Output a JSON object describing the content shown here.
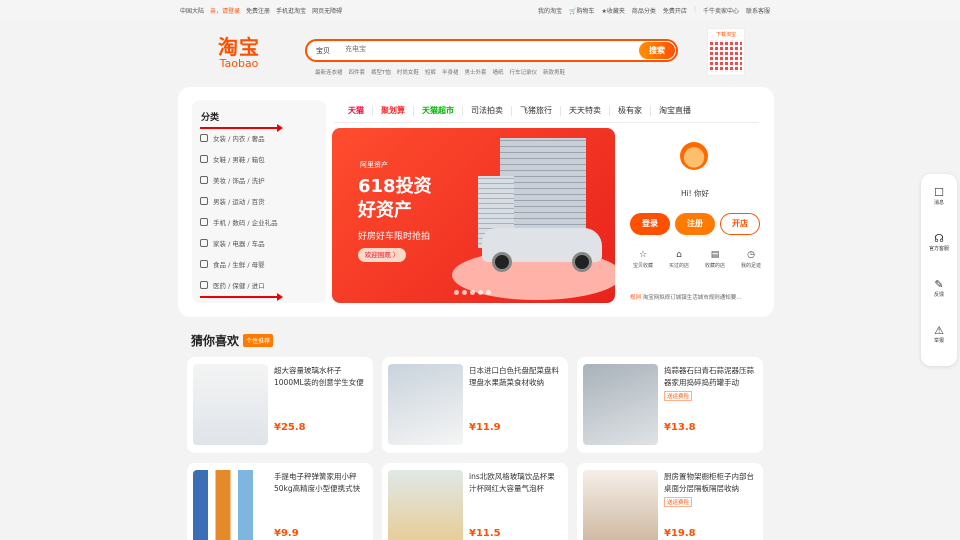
{
  "topbar": {
    "left": [
      "中国大陆",
      "亲，请登录",
      "免费注册",
      "手机逛淘宝",
      "网页无障碍"
    ],
    "right": [
      "我的淘宝",
      "购物车",
      "收藏夹",
      "商品分类",
      "免费开店",
      "千牛卖家中心",
      "联系客服"
    ]
  },
  "logo": {
    "cn": "淘宝",
    "en": "Taobao"
  },
  "search": {
    "category": "宝贝",
    "placeholder": "充电宝",
    "button": "搜索",
    "hotwords": [
      "最新连衣裙",
      "四件套",
      "裤型T恤",
      "时尚女鞋",
      "短裤",
      "半身裙",
      "男士外套",
      "墙纸",
      "行车记录仪",
      "新款男鞋"
    ]
  },
  "qrcode": {
    "label": "下载淘宝"
  },
  "categories": {
    "title": "分类",
    "items": [
      "女装 / 内衣 / 奢品",
      "女鞋 / 男鞋 / 箱包",
      "美妆 / 饰品 / 洗护",
      "男装 / 运动 / 百货",
      "手机 / 数码 / 企业礼品",
      "家装 / 电器 / 车品",
      "食品 / 生鲜 / 母婴",
      "医药 / 保健 / 进口"
    ]
  },
  "channels": [
    "天猫",
    "聚划算",
    "天猫超市",
    "司法拍卖",
    "飞猪旅行",
    "天天特卖",
    "极有家",
    "淘宝直播"
  ],
  "channel_colors": [
    "#ff0036",
    "#ff2d2d",
    "#00b500",
    "#333333",
    "#333333",
    "#333333",
    "#333333",
    "#333333"
  ],
  "banner": {
    "brand": "阿里资产",
    "headline1": "618投资",
    "headline2": "好资产",
    "subline": "好房好车限时抢拍",
    "cta": "欢迎围观 〉"
  },
  "user": {
    "greeting": "Hi! 你好",
    "login": "登录",
    "register": "注册",
    "open_shop": "开店",
    "shortcuts": [
      "宝贝收藏",
      "买过的店",
      "收藏的店",
      "我的足迹"
    ],
    "notice_tag": "规则",
    "notice": "淘宝网拟修订城镇生活城市规则通知要..."
  },
  "recommend": {
    "title": "猜你喜欢",
    "badge": "个性推荐",
    "products": [
      {
        "name": "超大容量玻璃水杯子1000ML装的创意学生女便",
        "price": "¥25.8",
        "tag": ""
      },
      {
        "name": "日本进口白色托盘配菜盘料理盘水果蔬菜食材收纳",
        "price": "¥11.9",
        "tag": ""
      },
      {
        "name": "捣蒜器石臼青石蒜泥器压蒜器家用捣碎捣药罐手动",
        "price": "¥13.8",
        "tag": "送运费险"
      },
      {
        "name": "手提电子秤弹簧家用小秤50kg高精度小型便携式快",
        "price": "¥9.9",
        "tag": ""
      },
      {
        "name": "ins北欧风格玻璃饮品杯果汁杯网红大容量气泡杯",
        "price": "¥11.5",
        "tag": ""
      },
      {
        "name": "厨房置物架橱柜柜子内部台桌面分层隔板隔层收纳",
        "price": "¥19.8",
        "tag": "送运费险"
      }
    ]
  },
  "sidebar": [
    "消息",
    "官方客服",
    "反馈",
    "举报"
  ],
  "colors": {
    "accent": "#ff5000",
    "annotation_arrow": "#e00000"
  }
}
